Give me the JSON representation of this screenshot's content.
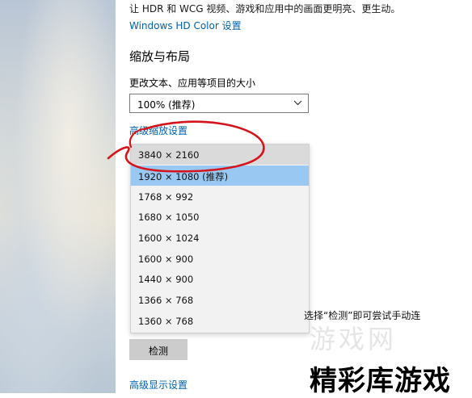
{
  "hdr": {
    "description": "让 HDR 和 WCG 视频、游戏和应用中的画面更明亮、更生动。",
    "link": "Windows HD Color 设置"
  },
  "scale_layout": {
    "title": "缩放与布局",
    "size_label": "更改文本、应用等项目的大小",
    "size_value": "100% (推荐)",
    "advanced_scaling_link": "高级缩放设置"
  },
  "resolution_dropdown": {
    "options": [
      "3840 × 2160",
      "1920 × 1080 (推荐)",
      "1768 × 992",
      "1680 × 1050",
      "1600 × 1024",
      "1600 × 900",
      "1440 × 900",
      "1366 × 768",
      "1360 × 768"
    ],
    "hovered_index": 0,
    "selected_index": 1
  },
  "multi_display": {
    "tip_text": "选择“检测”即可尝试手动连",
    "detect_button": "检测",
    "advanced_display_link": "高级显示设置"
  },
  "watermark": {
    "ghost": "游戏网",
    "text": "精彩库游戏"
  },
  "colors": {
    "link": "#0063b1",
    "selected": "#99c9f2",
    "hover": "#dadada",
    "annotation": "#d6141b"
  }
}
